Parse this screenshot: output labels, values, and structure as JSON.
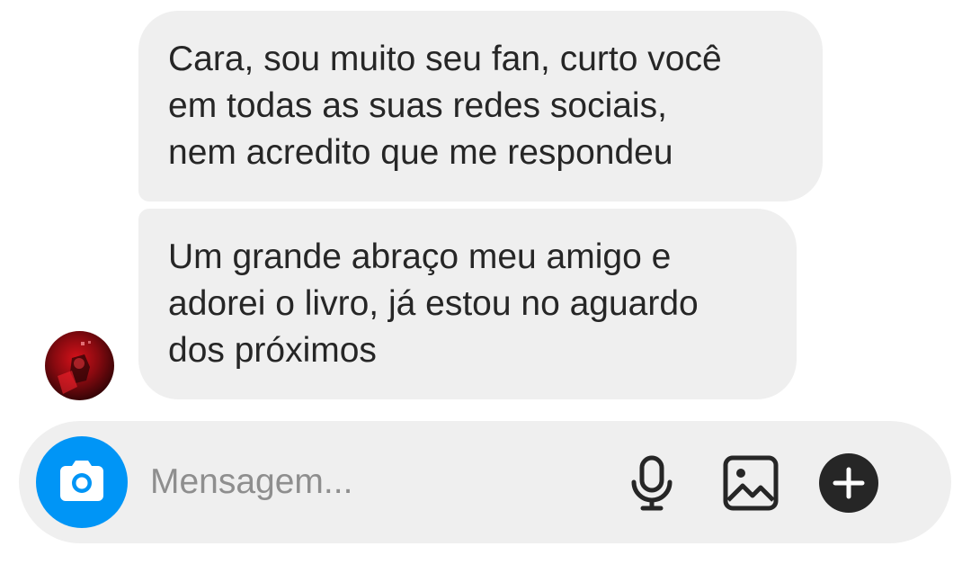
{
  "conversation": {
    "messages": [
      {
        "lines": [
          "Cara, sou muito seu fan, curto você",
          "em todas as suas redes sociais,",
          "nem acredito que me respondeu"
        ]
      },
      {
        "lines": [
          "Um grande abraço meu amigo e",
          "adorei o livro, já estou no aguardo",
          "dos próximos"
        ]
      }
    ],
    "sender_avatar": "avatar"
  },
  "composer": {
    "placeholder": "Mensagem...",
    "camera_icon": "camera-icon",
    "mic_icon": "microphone-icon",
    "gallery_icon": "image-gallery-icon",
    "plus_icon": "plus-circle-icon"
  },
  "colors": {
    "bubble": "#efefef",
    "text": "#262626",
    "placeholder": "#8e8e8e",
    "camera_button": "#0095f6",
    "icon": "#262626"
  }
}
